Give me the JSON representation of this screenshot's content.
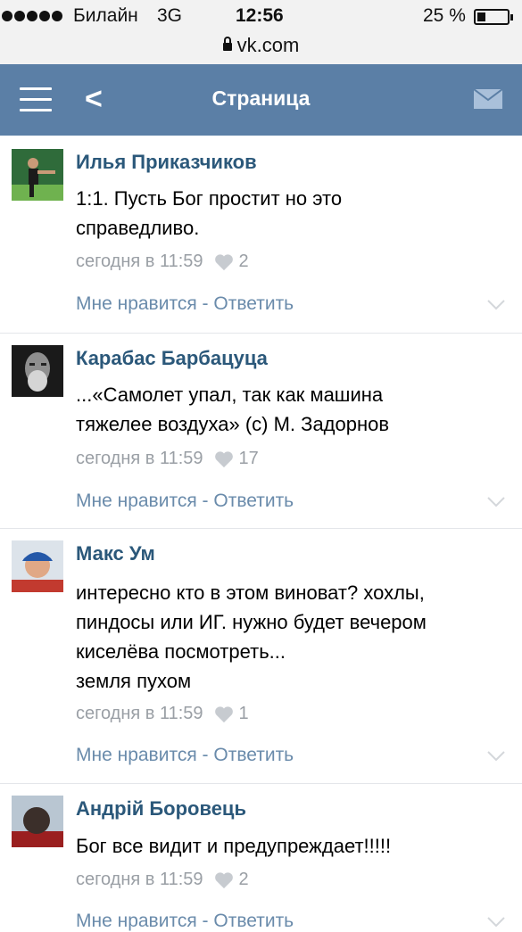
{
  "status_bar": {
    "carrier": "Билайн",
    "network": "3G",
    "time": "12:56",
    "battery_percent": "25 %",
    "battery_level": 0.25,
    "url": "vk.com"
  },
  "navbar": {
    "title": "Страница",
    "back_glyph": "<",
    "menu_icon": "hamburger-icon",
    "mail_icon": "mail-icon",
    "color": "#5b7fa6"
  },
  "comments": [
    {
      "author": "Илья Приказчиков",
      "lines": [
        "1:1. Пусть Бог простит но это",
        "справедливо."
      ],
      "time": "сегодня в 11:59",
      "likes": "2",
      "actions": "Мне нравится - Ответить"
    },
    {
      "author": "Карабас Барбацуца",
      "lines": [
        "...«Самолет упал, так как машина",
        "тяжелее воздуха» (с) М. Задорнов"
      ],
      "time": "сегодня в 11:59",
      "likes": "17",
      "actions": "Мне нравится - Ответить"
    },
    {
      "author": "Макс Ум",
      "lines": [
        "интересно кто в этом виноват? хохлы,",
        "пиндосы или ИГ. нужно будет вечером",
        "киселёва посмотреть...",
        "земля пухом"
      ],
      "time": "сегодня в 11:59",
      "likes": "1",
      "actions": "Мне нравится - Ответить"
    },
    {
      "author": "Андрій Боровець",
      "lines": [
        "Бог все видит и предупреждает!!!!!"
      ],
      "time": "сегодня в 11:59",
      "likes": "2",
      "actions": "Мне нравится - Ответить"
    }
  ],
  "colors": {
    "author": "#2b587a",
    "actions": "#6a8bab",
    "meta": "#9a9fa5"
  }
}
